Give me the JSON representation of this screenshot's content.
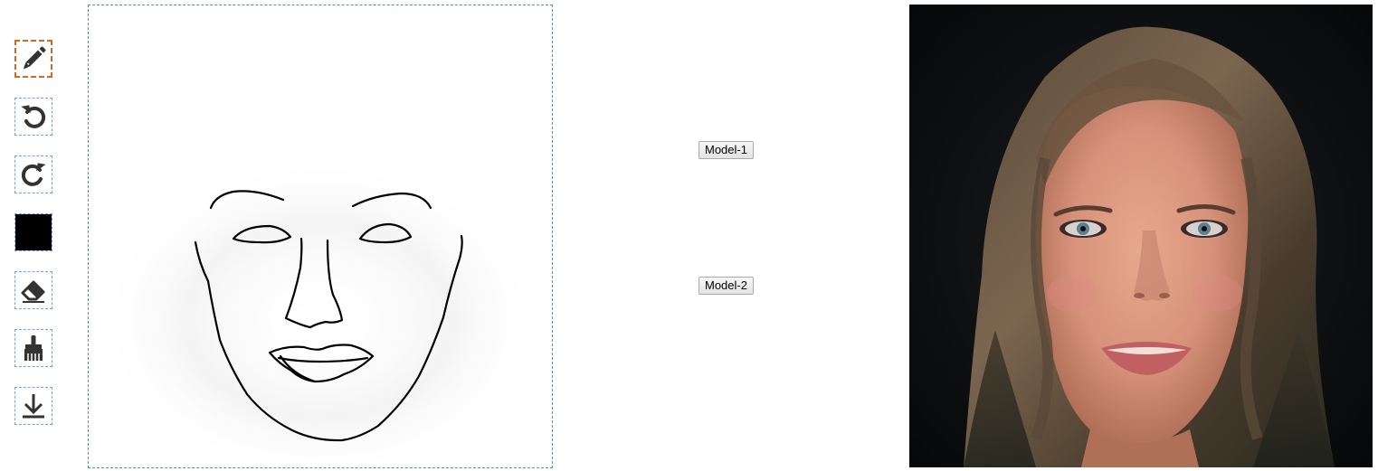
{
  "toolbar": {
    "tools": [
      {
        "name": "pencil",
        "icon": "pencil-icon",
        "active": true
      },
      {
        "name": "undo",
        "icon": "undo-icon",
        "active": false
      },
      {
        "name": "redo",
        "icon": "redo-icon",
        "active": false
      },
      {
        "name": "color",
        "icon": "color-swatch",
        "active": false,
        "color": "#000000"
      },
      {
        "name": "eraser",
        "icon": "eraser-icon",
        "active": false
      },
      {
        "name": "clear",
        "icon": "broom-icon",
        "active": false
      },
      {
        "name": "download",
        "icon": "download-icon",
        "active": false
      }
    ]
  },
  "buttons": {
    "model1": "Model-1",
    "model2": "Model-2"
  },
  "colors": {
    "active_border": "#d2691e",
    "tool_border": "#6aa6e8",
    "canvas_border": "#4a90d9",
    "stroke": "#000000"
  }
}
